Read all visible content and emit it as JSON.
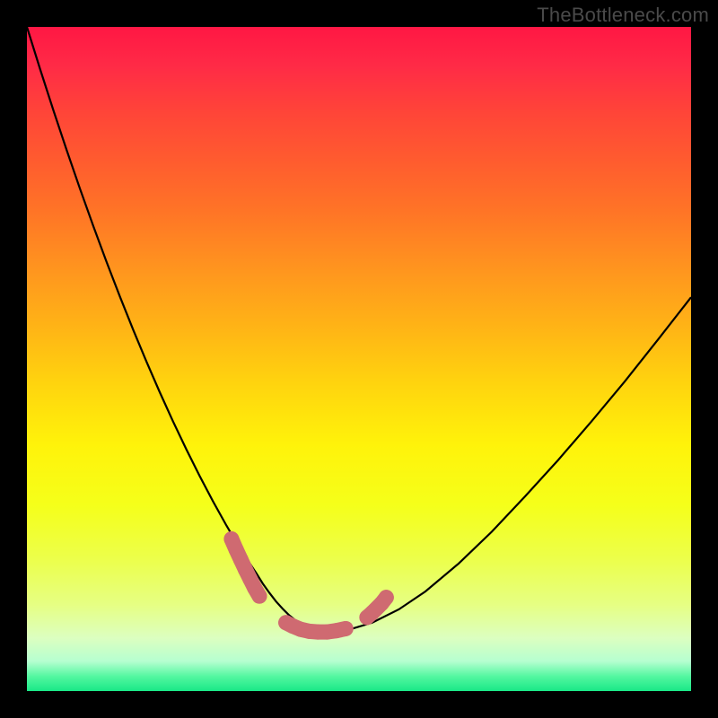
{
  "watermark": {
    "text": "TheBottleneck.com"
  },
  "gradient": {
    "stops": [
      {
        "offset": 0.0,
        "color": "#ff1744"
      },
      {
        "offset": 0.06,
        "color": "#ff2b46"
      },
      {
        "offset": 0.13,
        "color": "#ff4538"
      },
      {
        "offset": 0.2,
        "color": "#ff5b2f"
      },
      {
        "offset": 0.28,
        "color": "#ff7526"
      },
      {
        "offset": 0.36,
        "color": "#ff931f"
      },
      {
        "offset": 0.45,
        "color": "#ffb316"
      },
      {
        "offset": 0.54,
        "color": "#ffd50e"
      },
      {
        "offset": 0.63,
        "color": "#fff30a"
      },
      {
        "offset": 0.72,
        "color": "#f5ff1a"
      },
      {
        "offset": 0.8,
        "color": "#ecff4a"
      },
      {
        "offset": 0.87,
        "color": "#e6ff83"
      },
      {
        "offset": 0.92,
        "color": "#dcffc0"
      },
      {
        "offset": 0.955,
        "color": "#b6ffd0"
      },
      {
        "offset": 0.978,
        "color": "#53f7a0"
      },
      {
        "offset": 1.0,
        "color": "#19e887"
      }
    ]
  },
  "chart_data": {
    "type": "line",
    "title": "",
    "xlabel": "",
    "ylabel": "",
    "xlim": [
      0,
      1
    ],
    "ylim": [
      0,
      1
    ],
    "series": [
      {
        "name": "bottleneck-curve",
        "x": [
          0.0,
          0.02,
          0.04,
          0.06,
          0.08,
          0.1,
          0.12,
          0.14,
          0.16,
          0.18,
          0.2,
          0.22,
          0.24,
          0.26,
          0.28,
          0.3,
          0.32,
          0.333,
          0.345,
          0.355,
          0.365,
          0.375,
          0.385,
          0.395,
          0.405,
          0.418,
          0.43,
          0.445,
          0.465,
          0.49,
          0.52,
          0.56,
          0.6,
          0.65,
          0.7,
          0.75,
          0.8,
          0.85,
          0.9,
          0.95,
          1.0
        ],
        "y": [
          1.0,
          0.936,
          0.874,
          0.814,
          0.756,
          0.7,
          0.646,
          0.594,
          0.544,
          0.496,
          0.45,
          0.406,
          0.364,
          0.324,
          0.286,
          0.25,
          0.216,
          0.196,
          0.178,
          0.162,
          0.148,
          0.135,
          0.124,
          0.114,
          0.106,
          0.099,
          0.093,
          0.09,
          0.09,
          0.094,
          0.103,
          0.123,
          0.15,
          0.192,
          0.24,
          0.293,
          0.348,
          0.406,
          0.466,
          0.529,
          0.593
        ]
      }
    ],
    "markers": [
      {
        "name": "left-cluster",
        "color": "#cf6a71",
        "points": [
          {
            "x": 0.308,
            "y": 0.229
          },
          {
            "x": 0.315,
            "y": 0.213
          },
          {
            "x": 0.322,
            "y": 0.198
          },
          {
            "x": 0.329,
            "y": 0.183
          },
          {
            "x": 0.336,
            "y": 0.169
          },
          {
            "x": 0.343,
            "y": 0.155
          },
          {
            "x": 0.35,
            "y": 0.143
          }
        ]
      },
      {
        "name": "bottom-cluster",
        "color": "#cf6a71",
        "points": [
          {
            "x": 0.39,
            "y": 0.103
          },
          {
            "x": 0.4,
            "y": 0.098
          },
          {
            "x": 0.412,
            "y": 0.093
          },
          {
            "x": 0.425,
            "y": 0.09
          },
          {
            "x": 0.438,
            "y": 0.089
          },
          {
            "x": 0.452,
            "y": 0.089
          },
          {
            "x": 0.466,
            "y": 0.091
          },
          {
            "x": 0.48,
            "y": 0.094
          }
        ]
      },
      {
        "name": "right-cluster",
        "color": "#cf6a71",
        "points": [
          {
            "x": 0.512,
            "y": 0.111
          },
          {
            "x": 0.52,
            "y": 0.118
          },
          {
            "x": 0.534,
            "y": 0.132
          },
          {
            "x": 0.541,
            "y": 0.141
          }
        ]
      }
    ]
  }
}
